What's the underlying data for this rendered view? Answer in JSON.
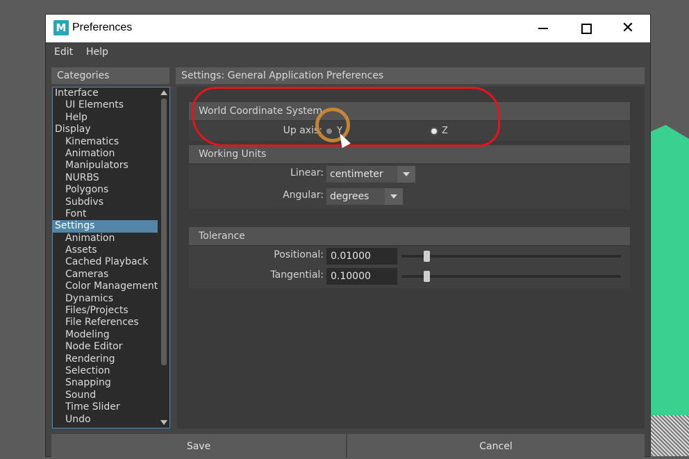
{
  "window": {
    "title": "Preferences",
    "logo_letter": "M"
  },
  "menu": {
    "edit": "Edit",
    "help": "Help"
  },
  "categories": {
    "header": "Categories",
    "items": [
      {
        "label": "Interface",
        "level": 0
      },
      {
        "label": "UI Elements",
        "level": 1
      },
      {
        "label": "Help",
        "level": 1
      },
      {
        "label": "Display",
        "level": 0
      },
      {
        "label": "Kinematics",
        "level": 1
      },
      {
        "label": "Animation",
        "level": 1
      },
      {
        "label": "Manipulators",
        "level": 1
      },
      {
        "label": "NURBS",
        "level": 1
      },
      {
        "label": "Polygons",
        "level": 1
      },
      {
        "label": "Subdivs",
        "level": 1
      },
      {
        "label": "Font",
        "level": 1
      },
      {
        "label": "Settings",
        "level": 0,
        "selected": true
      },
      {
        "label": "Animation",
        "level": 1
      },
      {
        "label": "Assets",
        "level": 1
      },
      {
        "label": "Cached Playback",
        "level": 1
      },
      {
        "label": "Cameras",
        "level": 1
      },
      {
        "label": "Color Management",
        "level": 1
      },
      {
        "label": "Dynamics",
        "level": 1
      },
      {
        "label": "Files/Projects",
        "level": 1
      },
      {
        "label": "File References",
        "level": 1
      },
      {
        "label": "Modeling",
        "level": 1
      },
      {
        "label": "Node Editor",
        "level": 1
      },
      {
        "label": "Rendering",
        "level": 1
      },
      {
        "label": "Selection",
        "level": 1
      },
      {
        "label": "Snapping",
        "level": 1
      },
      {
        "label": "Sound",
        "level": 1
      },
      {
        "label": "Time Slider",
        "level": 1
      },
      {
        "label": "Undo",
        "level": 1
      }
    ]
  },
  "settings": {
    "header": "Settings: General Application Preferences",
    "world": {
      "title": "World Coordinate System",
      "up_axis_label": "Up axis:",
      "options": [
        "Y",
        "Z"
      ],
      "selected": "Z"
    },
    "units": {
      "title": "Working Units",
      "linear_label": "Linear:",
      "linear_value": "centimeter",
      "angular_label": "Angular:",
      "angular_value": "degrees"
    },
    "tolerance": {
      "title": "Tolerance",
      "positional_label": "Positional:",
      "positional_value": "0.01000",
      "positional_slider": 0.1,
      "tangential_label": "Tangential:",
      "tangential_value": "0.10000",
      "tangential_slider": 0.1
    }
  },
  "buttons": {
    "save": "Save",
    "cancel": "Cancel"
  },
  "colors": {
    "annotation": "#e8141a",
    "selection": "#5285a6",
    "accent": "#2aa7b5"
  }
}
